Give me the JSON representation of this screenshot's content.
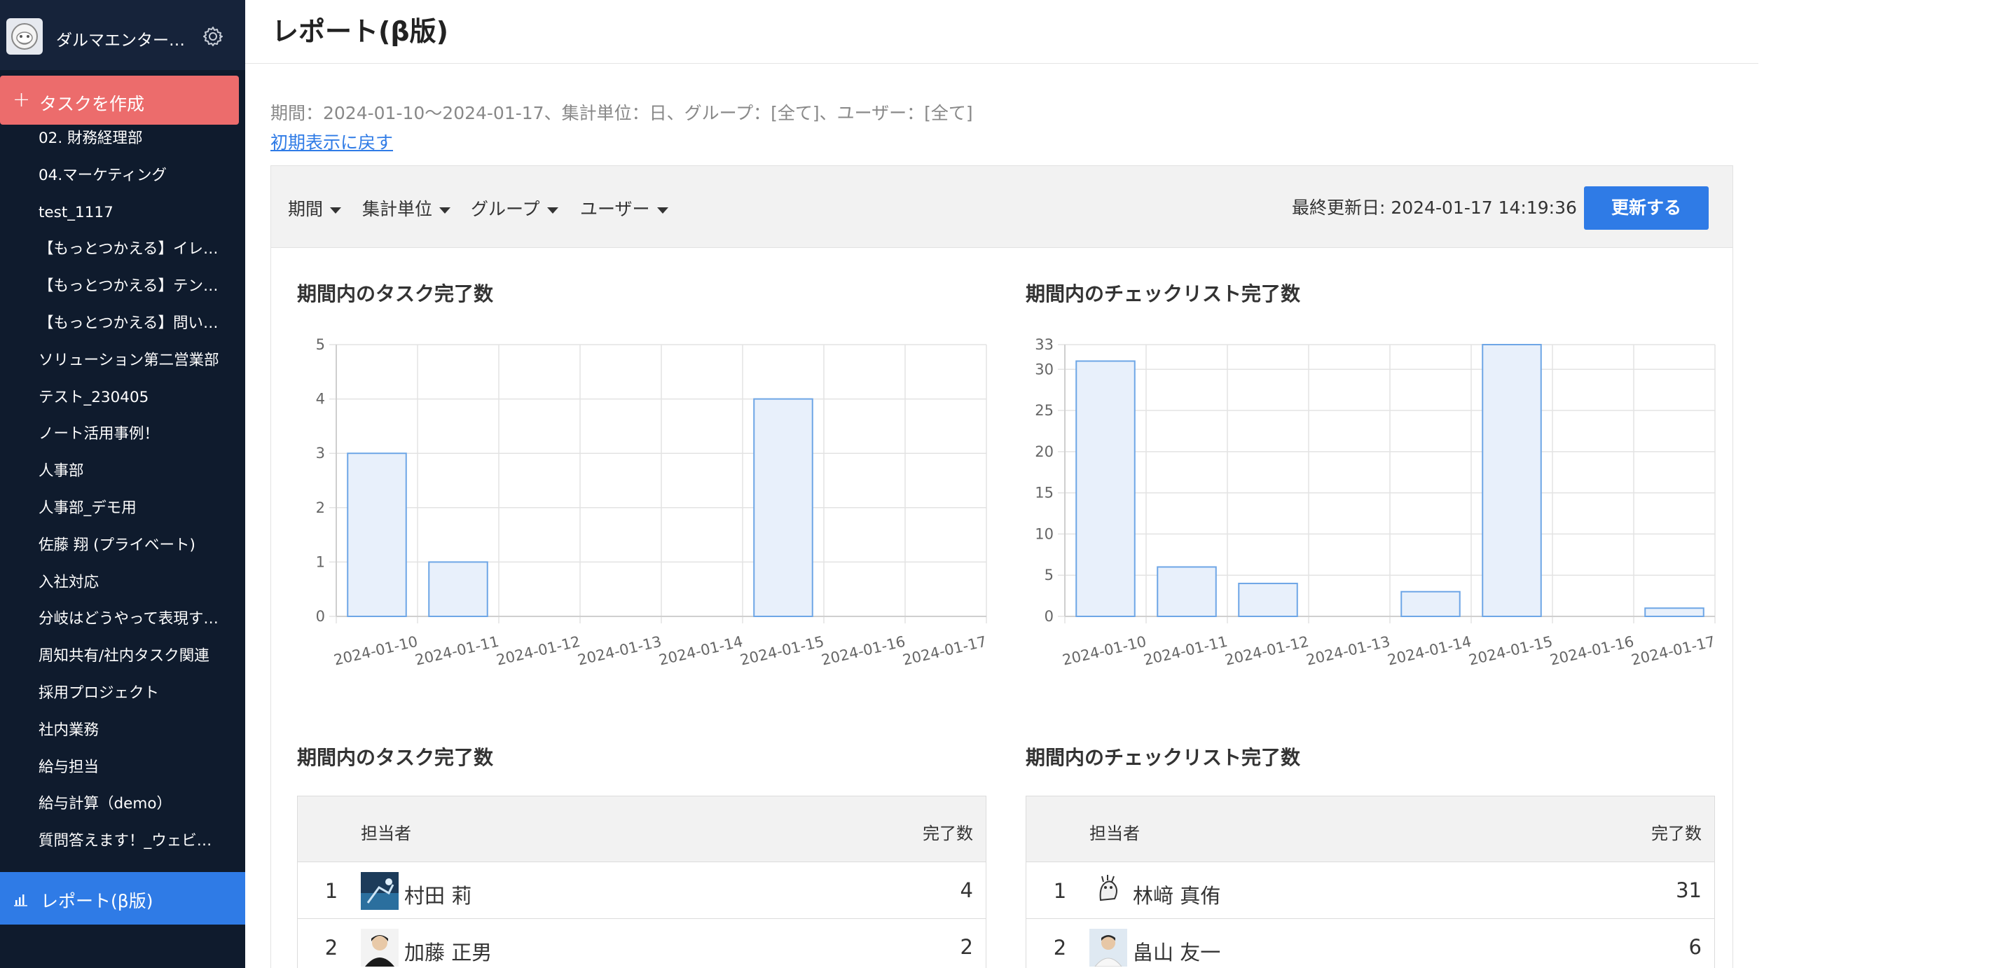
{
  "sidebar": {
    "workspace_name": "ダルマエンター…",
    "create_task_label": "タスクを作成",
    "items": [
      {
        "label": "02. 財務経理部"
      },
      {
        "label": "04.マーケティング"
      },
      {
        "label": "test_1117"
      },
      {
        "label": "【もっとつかえる】イレ…"
      },
      {
        "label": "【もっとつかえる】テン…"
      },
      {
        "label": "【もっとつかえる】問い…"
      },
      {
        "label": "ソリューション第二営業部"
      },
      {
        "label": "テスト_230405"
      },
      {
        "label": "ノート活用事例！"
      },
      {
        "label": "人事部"
      },
      {
        "label": "人事部_デモ用"
      },
      {
        "label": "佐藤 翔 (プライベート)"
      },
      {
        "label": "入社対応"
      },
      {
        "label": "分岐はどうやって表現す…"
      },
      {
        "label": "周知共有/社内タスク関連"
      },
      {
        "label": "採用プロジェクト"
      },
      {
        "label": "社内業務"
      },
      {
        "label": "給与担当"
      },
      {
        "label": "給与計算（demo）"
      },
      {
        "label": "質問答えます！_ウェビ…"
      }
    ],
    "report_label": "レポート(β版)"
  },
  "page": {
    "title": "レポート(β版)",
    "filter_summary": "期間：2024-01-10〜2024-01-17、集計単位：日、グループ：[全て]、ユーザー：[全て]",
    "reset_link": "初期表示に戻す"
  },
  "toolbar": {
    "period_label": "期間",
    "unit_label": "集計単位",
    "group_label": "グループ",
    "user_label": "ユーザー",
    "last_updated": "最終更新日: 2024-01-17 14:19:36",
    "update_button": "更新する"
  },
  "colors": {
    "accent": "#2f7be6",
    "create_button": "#ec6c6c",
    "sidebar_bg": "#0f1b2d",
    "bar_fill": "#e8f0fb",
    "bar_stroke": "#6ea6e6"
  },
  "chart_data": [
    {
      "type": "bar",
      "title": "期間内のタスク完了数",
      "categories": [
        "2024-01-10",
        "2024-01-11",
        "2024-01-12",
        "2024-01-13",
        "2024-01-14",
        "2024-01-15",
        "2024-01-16",
        "2024-01-17"
      ],
      "values": [
        3,
        1,
        0,
        0,
        0,
        4,
        0,
        0
      ],
      "yticks": [
        0,
        1,
        2,
        3,
        4,
        5
      ],
      "ylim": [
        0,
        5
      ],
      "grid": true
    },
    {
      "type": "bar",
      "title": "期間内のチェックリスト完了数",
      "categories": [
        "2024-01-10",
        "2024-01-11",
        "2024-01-12",
        "2024-01-13",
        "2024-01-14",
        "2024-01-15",
        "2024-01-16",
        "2024-01-17"
      ],
      "values": [
        31,
        6,
        4,
        0,
        3,
        33,
        0,
        1
      ],
      "yticks": [
        0,
        5,
        10,
        15,
        20,
        25,
        30,
        33
      ],
      "ylim": [
        0,
        33
      ],
      "grid": true
    }
  ],
  "tables": [
    {
      "title": "期間内のタスク完了数",
      "header_assignee": "担当者",
      "header_count": "完了数",
      "rows": [
        {
          "rank": "1",
          "name": "村田 莉",
          "count": "4"
        },
        {
          "rank": "2",
          "name": "加藤 正男",
          "count": "2"
        }
      ]
    },
    {
      "title": "期間内のチェックリスト完了数",
      "header_assignee": "担当者",
      "header_count": "完了数",
      "rows": [
        {
          "rank": "1",
          "name": "林﨑 真侑",
          "count": "31"
        },
        {
          "rank": "2",
          "name": "畠山 友一",
          "count": "6"
        }
      ]
    }
  ]
}
